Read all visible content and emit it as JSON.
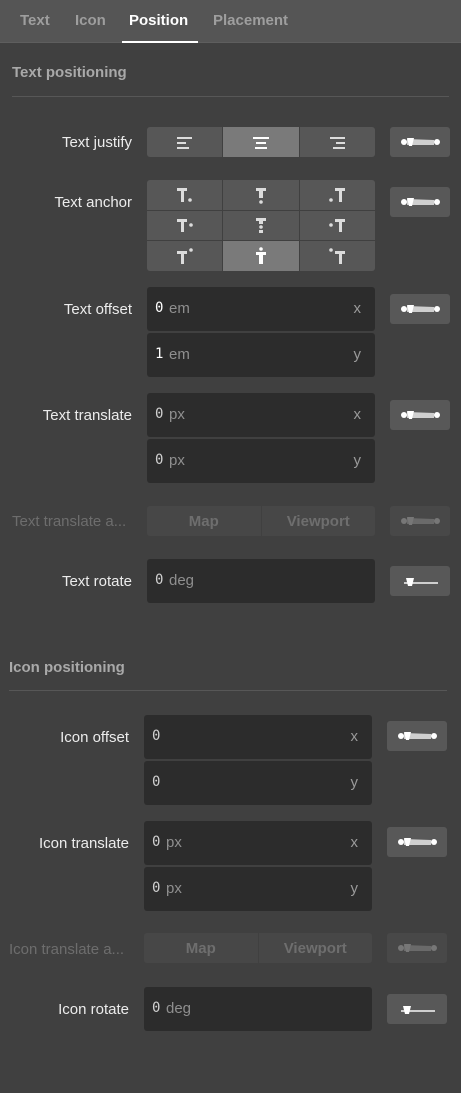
{
  "tabs": [
    "Text",
    "Icon",
    "Position",
    "Placement"
  ],
  "active_tab": "Position",
  "text_section": {
    "title": "Text positioning",
    "justify_label": "Text justify",
    "justify_options": [
      "left-align-icon",
      "center-align-icon",
      "right-align-icon"
    ],
    "justify_selected": "center",
    "anchor_label": "Text anchor",
    "anchor_selected": "center",
    "offset_label": "Text offset",
    "offset_x": "0",
    "offset_y": "1",
    "offset_unit": "em",
    "translate_label": "Text translate",
    "translate_x": "0",
    "translate_y": "0",
    "translate_unit": "px",
    "translate_anchor_label": "Text translate a...",
    "rotate_label": "Text rotate",
    "rotate_value": "0",
    "rotate_unit": "deg"
  },
  "icon_section": {
    "title": "Icon positioning",
    "offset_label": "Icon offset",
    "offset_x": "0",
    "offset_y": "0",
    "translate_label": "Icon translate",
    "translate_x": "0",
    "translate_y": "0",
    "translate_unit": "px",
    "translate_anchor_label": "Icon translate a...",
    "rotate_label": "Icon rotate",
    "rotate_value": "0",
    "rotate_unit": "deg"
  },
  "axis_x": "x",
  "axis_y": "y",
  "anchor_map": "Map",
  "anchor_viewport": "Viewport"
}
